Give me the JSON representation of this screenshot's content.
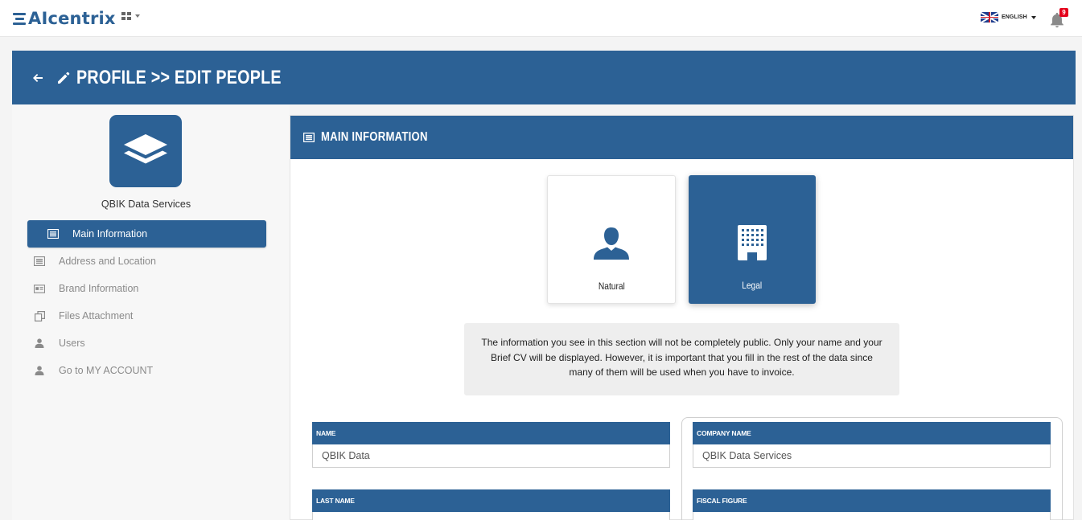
{
  "app": {
    "logo_text": "AIcentrix",
    "language": "ENGLISH",
    "notification_count": "9"
  },
  "header": {
    "title": "PROFILE  >> EDIT PEOPLE"
  },
  "sidebar": {
    "company_name": "QBIK Data Services",
    "items": [
      {
        "label": "Main Information",
        "icon": "list-icon",
        "active": true
      },
      {
        "label": "Address and Location",
        "icon": "list-icon",
        "active": false
      },
      {
        "label": "Brand Information",
        "icon": "id-card-icon",
        "active": false
      },
      {
        "label": "Files Attachment",
        "icon": "copy-icon",
        "active": false
      },
      {
        "label": "Users",
        "icon": "user-icon",
        "active": false
      },
      {
        "label": "Go to MY ACCOUNT",
        "icon": "user-icon",
        "active": false
      }
    ]
  },
  "main": {
    "section_title": "MAIN INFORMATION",
    "person_types": [
      {
        "label": "Natural",
        "icon": "person-icon",
        "selected": false
      },
      {
        "label": "Legal",
        "icon": "building-icon",
        "selected": true
      }
    ],
    "info_text": "The information you see in this section will not be completely public. Only your name and your Brief CV will be displayed. However, it is important that you fill in the rest of the data since many of them will be used when you have to invoice.",
    "fields": {
      "name": {
        "label": "NAME",
        "value": "QBIK Data"
      },
      "last_name": {
        "label": "LAST NAME",
        "value": ""
      },
      "company_name": {
        "label": "COMPANY NAME",
        "value": "QBIK Data Services"
      },
      "fiscal_figure": {
        "label": "FISCAL FIGURE",
        "value": ""
      }
    }
  },
  "colors": {
    "primary": "#2c6195",
    "badge": "#e4001b"
  }
}
